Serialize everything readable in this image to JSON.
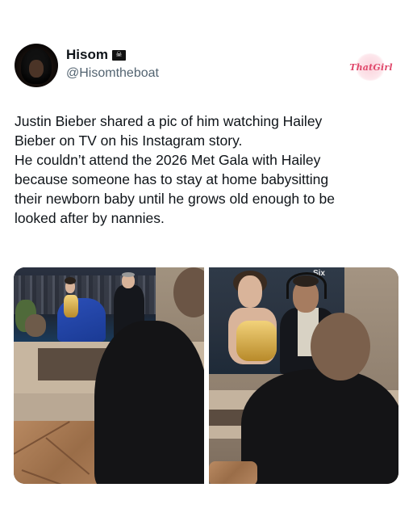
{
  "user": {
    "display_name": "Hisom",
    "handle": "@Hisomtheboat",
    "badge_icon": "pirate-flag-icon"
  },
  "watermark": {
    "text": "ThatGirl"
  },
  "tweet": {
    "lines": [
      "Justin Bieber shared a pic of him watching Hailey",
      "Bieber on TV on his Instagram story.",
      "He couldn’t attend the 2026 Met Gala with Hailey",
      "because someone has to stay at home babysitting",
      "their newborn baby until he grows old enough to be",
      "looked after by nannies."
    ]
  },
  "media": {
    "tv_channel_logo": "Six"
  }
}
